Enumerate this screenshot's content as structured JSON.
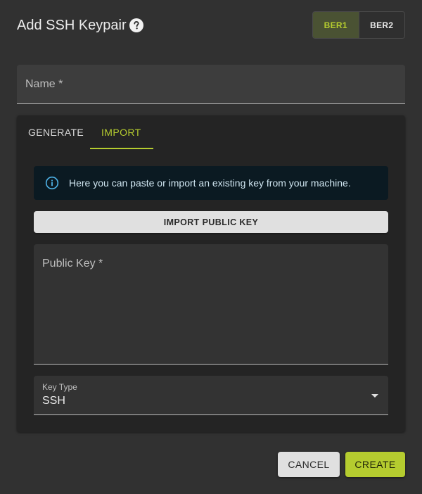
{
  "dialog": {
    "title": "Add SSH Keypair",
    "help_icon": "help-circle-icon"
  },
  "regions": {
    "items": [
      "BER1",
      "BER2"
    ],
    "selected": "BER1"
  },
  "name_field": {
    "label": "Name *",
    "value": ""
  },
  "tabs": [
    {
      "label": "GENERATE",
      "active": false
    },
    {
      "label": "IMPORT",
      "active": true
    }
  ],
  "alert": {
    "icon": "info-icon",
    "text": "Here you can paste or import an existing key from your machine."
  },
  "import_button": {
    "label": "IMPORT PUBLIC KEY"
  },
  "public_key_field": {
    "label": "Public Key *",
    "value": ""
  },
  "key_type": {
    "label": "Key Type",
    "value": "SSH"
  },
  "actions": {
    "cancel_label": "CANCEL",
    "create_label": "CREATE"
  },
  "colors": {
    "accent": "#b5cc2f",
    "background": "#313131",
    "card": "#242424",
    "alert_bg": "#0b1a22",
    "info_blue": "#4fb3e8"
  }
}
